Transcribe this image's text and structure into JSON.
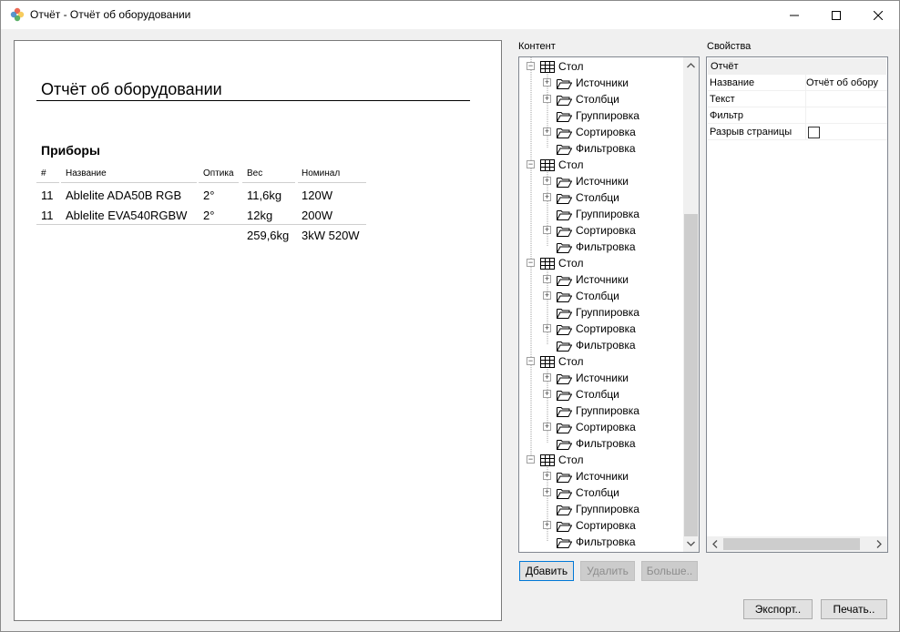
{
  "window": {
    "title": "Отчёт - Отчёт об оборудовании"
  },
  "report": {
    "title": "Отчёт об оборудовании",
    "section_title": "Приборы",
    "columns": [
      "#",
      "Название",
      "Оптика",
      "Вес",
      "Номинал"
    ],
    "rows": [
      [
        "11",
        "Ablelite ADA50B RGB",
        "2°",
        "11,6kg",
        "120W"
      ],
      [
        "11",
        "Ablelite EVA540RGBW",
        "2°",
        "12kg",
        "200W"
      ]
    ],
    "totals": [
      "",
      "",
      "",
      "259,6kg",
      "3kW 520W"
    ]
  },
  "content_panel": {
    "label": "Контент",
    "groups": [
      {
        "label": "Стол",
        "children": [
          "Источники",
          "Столбци",
          "Группировка",
          "Сортировка",
          "Фильтровка"
        ]
      },
      {
        "label": "Стол",
        "children": [
          "Источники",
          "Столбци",
          "Группировка",
          "Сортировка",
          "Фильтровка"
        ]
      },
      {
        "label": "Стол",
        "children": [
          "Источники",
          "Столбци",
          "Группировка",
          "Сортировка",
          "Фильтровка"
        ]
      },
      {
        "label": "Стол",
        "children": [
          "Источники",
          "Столбци",
          "Группировка",
          "Сортировка",
          "Фильтровка"
        ]
      },
      {
        "label": "Стол",
        "children": [
          "Источники",
          "Столбци",
          "Группировка",
          "Сортировка",
          "Фильтровка"
        ]
      }
    ],
    "buttons": {
      "add": "Дбавить",
      "delete": "Удалить",
      "more": "Больше.."
    }
  },
  "properties_panel": {
    "label": "Свойства",
    "header": "Отчёт",
    "rows": [
      {
        "name": "Название",
        "value": "Отчёт об обору"
      },
      {
        "name": "Текст",
        "value": ""
      },
      {
        "name": "Фильтр",
        "value": ""
      },
      {
        "name": "Разрыв страницы",
        "value": ""
      }
    ],
    "page_break_checked": false
  },
  "footer": {
    "export": "Экспорт..",
    "print": "Печать.."
  }
}
